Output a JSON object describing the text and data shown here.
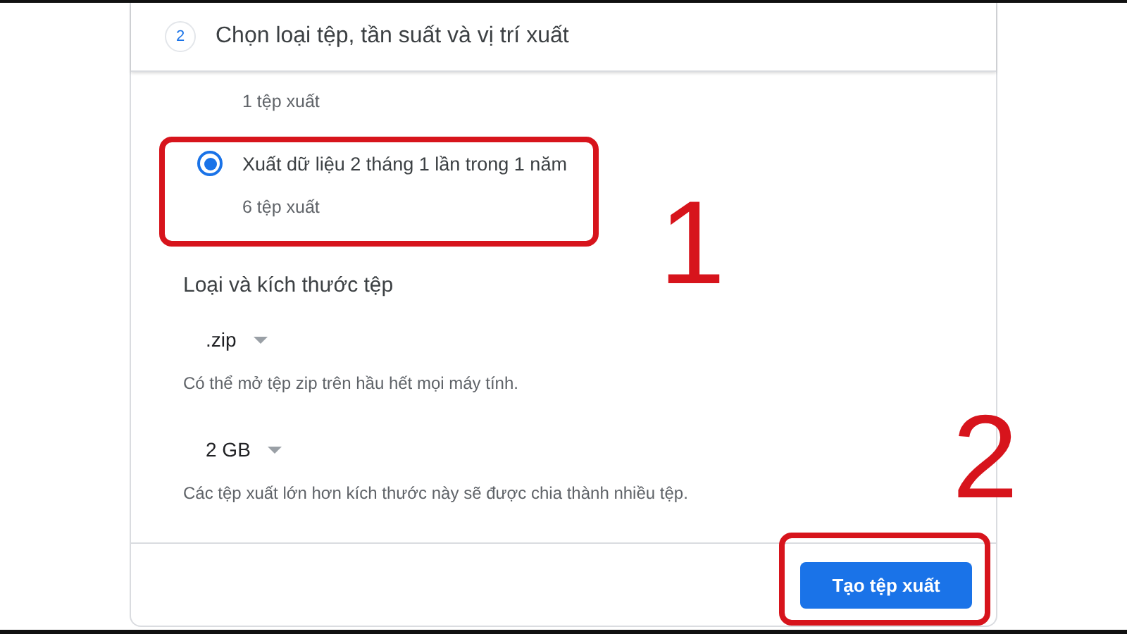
{
  "step": {
    "number": "2",
    "title": "Chọn loại tệp, tần suất và vị trí xuất"
  },
  "partial_option_hint": "1 tệp xuất",
  "frequency_options": [
    {
      "label": "Xuất dữ liệu 2 tháng 1 lần trong 1 năm",
      "hint": "6 tệp xuất",
      "selected": true
    }
  ],
  "file_section": {
    "title": "Loại và kích thước tệp",
    "dropdowns": [
      {
        "value": ".zip",
        "hint": "Có thể mở tệp zip trên hầu hết mọi máy tính."
      },
      {
        "value": "2 GB",
        "hint": "Các tệp xuất lớn hơn kích thước này sẽ được chia thành nhiều tệp."
      }
    ]
  },
  "create_button": "Tạo tệp xuất",
  "annotations": [
    {
      "label": "1"
    },
    {
      "label": "2"
    }
  ]
}
